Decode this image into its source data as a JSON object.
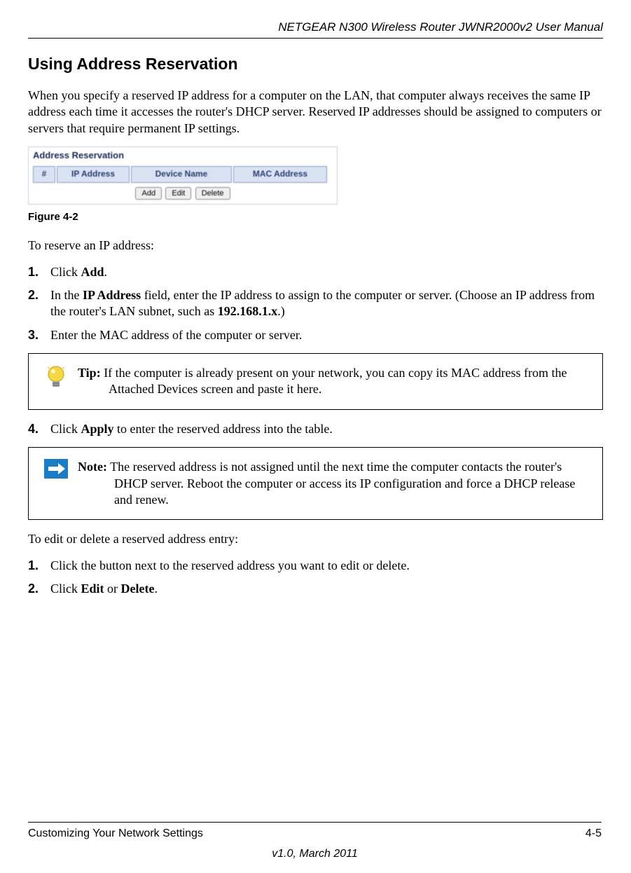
{
  "header": {
    "manual_title": "NETGEAR N300 Wireless Router JWNR2000v2 User Manual"
  },
  "section": {
    "title": "Using Address Reservation"
  },
  "intro": "When you specify a reserved IP address for a computer on the LAN, that computer always receives the same IP address each time it accesses the router's DHCP server. Reserved IP addresses should be assigned to computers or servers that require permanent IP settings.",
  "screenshot": {
    "panel_title": "Address Reservation",
    "cols": {
      "num": "#",
      "ip": "IP Address",
      "dev": "Device Name",
      "mac": "MAC Address"
    },
    "buttons": {
      "add": "Add",
      "edit": "Edit",
      "delete": "Delete"
    }
  },
  "figure_caption": "Figure 4-2",
  "reserve_intro": "To reserve an IP address:",
  "steps_reserve": [
    {
      "num": "1.",
      "pre": "Click ",
      "b1": "Add",
      "post": "."
    },
    {
      "num": "2.",
      "pre": "In the ",
      "b1": "IP Address",
      "mid": " field, enter the IP address to assign to the computer or server. (Choose an IP address from the router's LAN subnet, such as ",
      "b2": "192.168.1.x",
      "post": ".)"
    },
    {
      "num": "3.",
      "pre": "Enter the MAC address of the computer or server."
    }
  ],
  "tip": {
    "label": "Tip:",
    "text": " If the computer is already present on your network, you can copy its MAC address from the Attached Devices screen and paste it here."
  },
  "step4": {
    "num": "4.",
    "pre": "Click ",
    "b1": "Apply",
    "post": " to enter the reserved address into the table."
  },
  "note": {
    "label": "Note:",
    "text": " The reserved address is not assigned until the next time the computer contacts the router's DHCP server. Reboot the computer or access its IP configuration and force a DHCP release and renew."
  },
  "edit_intro": "To edit or delete a reserved address entry:",
  "steps_edit": [
    {
      "num": "1.",
      "pre": "Click the button next to the reserved address you want to edit or delete."
    },
    {
      "num": "2.",
      "pre": "Click ",
      "b1": "Edit",
      "mid": " or ",
      "b2": "Delete",
      "post": "."
    }
  ],
  "footer": {
    "left": "Customizing Your Network Settings",
    "right": "4-5",
    "center": "v1.0, March 2011"
  }
}
